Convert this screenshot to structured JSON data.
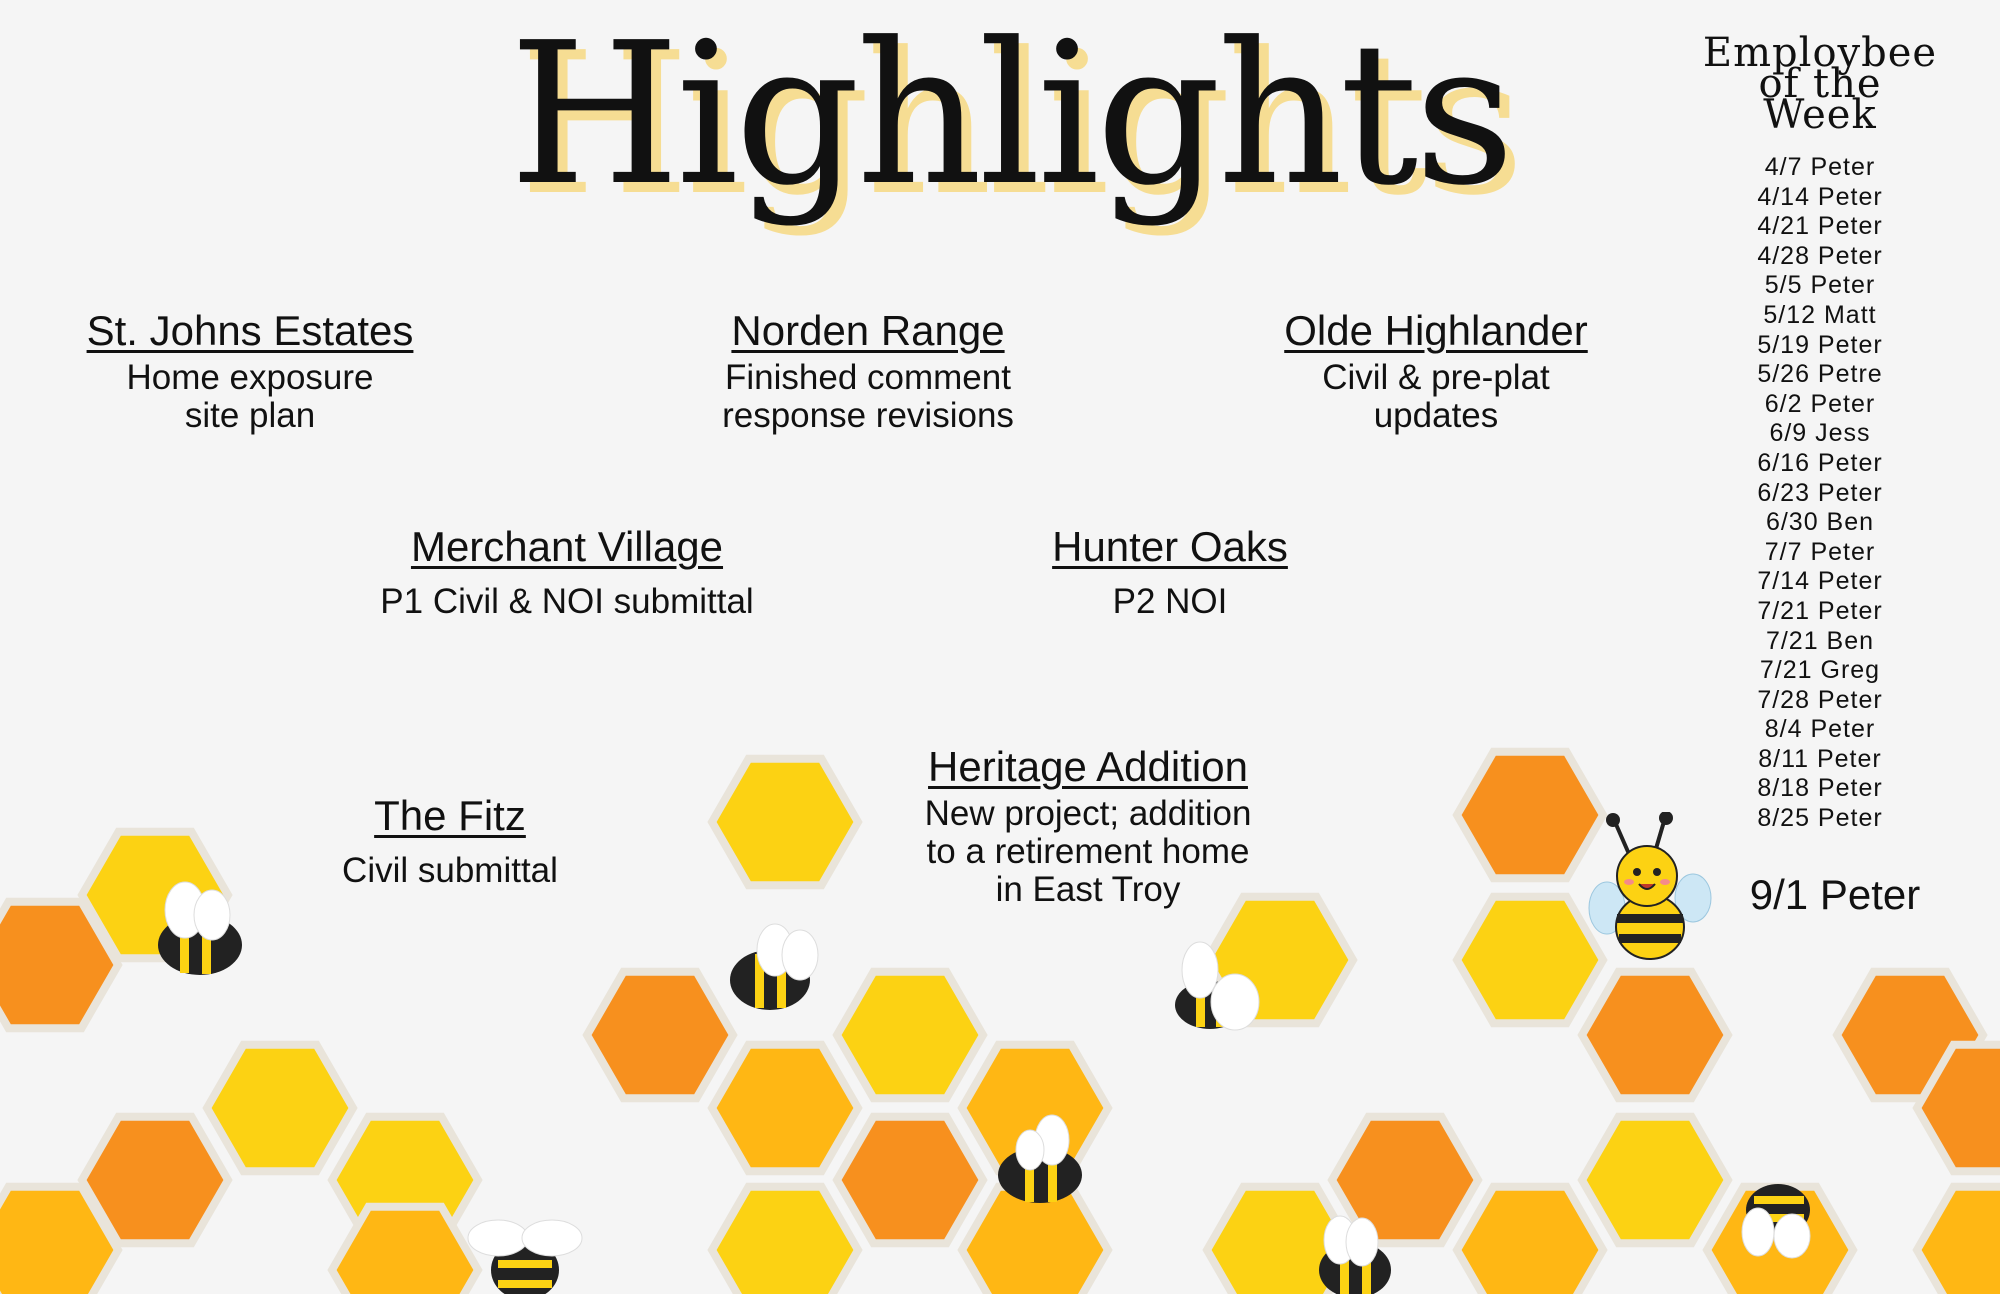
{
  "title": "Highlights",
  "projects": [
    {
      "name": "St. Johns Estates",
      "desc": "Home exposure\nsite plan"
    },
    {
      "name": "Norden Range",
      "desc": "Finished comment\nresponse revisions"
    },
    {
      "name": "Olde Highlander",
      "desc": "Civil & pre-plat\nupdates"
    },
    {
      "name": "Merchant Village",
      "desc": "P1 Civil & NOI submittal"
    },
    {
      "name": "Hunter Oaks",
      "desc": "P2 NOI"
    },
    {
      "name": "The Fitz",
      "desc": "Civil submittal"
    },
    {
      "name": "Heritage Addition",
      "desc": "New project; addition\nto a retirement home\nin East Troy"
    }
  ],
  "employee_of_week": {
    "heading": "Employbee\nof the\nWeek",
    "entries": [
      "4/7 Peter",
      "4/14 Peter",
      "4/21 Peter",
      "4/28 Peter",
      "5/5 Peter",
      "5/12 Matt",
      "5/19 Peter",
      "5/26 Petre",
      "6/2 Peter",
      "6/9 Jess",
      "6/16 Peter",
      "6/23 Peter",
      "6/30 Ben",
      "7/7 Peter",
      "7/14 Peter",
      "7/21 Peter",
      "7/21 Ben",
      "7/21 Greg",
      "7/28 Peter",
      "8/4 Peter",
      "8/11 Peter",
      "8/18 Peter",
      "8/25 Peter"
    ],
    "current": "9/1 Peter"
  },
  "colors": {
    "title_shadow": "#f6dd93",
    "honey_yellow": "#fcd213",
    "honey_amber": "#ffb714",
    "honey_orange": "#f7901e",
    "bee_body": "#222222"
  }
}
